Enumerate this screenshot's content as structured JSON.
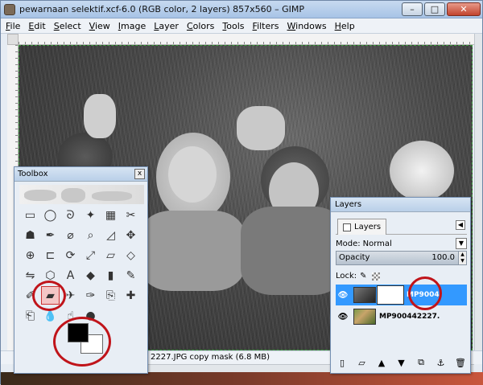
{
  "window": {
    "title": "pewarnaan selektif.xcf-6.0 (RGB color, 2 layers) 857x560 – GIMP",
    "controls": {
      "minimize": "–",
      "maximize": "□",
      "close": "✕"
    }
  },
  "menubar": [
    "File",
    "Edit",
    "Select",
    "View",
    "Image",
    "Layer",
    "Colors",
    "Tools",
    "Filters",
    "Windows",
    "Help"
  ],
  "status": {
    "text": "2227.JPG copy mask (6.8 MB)"
  },
  "toolbox": {
    "title": "Toolbox",
    "close": "x",
    "tools": [
      {
        "name": "rect-select-icon",
        "glyph": "▭"
      },
      {
        "name": "ellipse-select-icon",
        "glyph": "◯"
      },
      {
        "name": "lasso-icon",
        "glyph": "ᘐ"
      },
      {
        "name": "fuzzy-select-icon",
        "glyph": "✦"
      },
      {
        "name": "color-select-icon",
        "glyph": "▦"
      },
      {
        "name": "scissors-icon",
        "glyph": "✂"
      },
      {
        "name": "foreground-select-icon",
        "glyph": "☗"
      },
      {
        "name": "paths-icon",
        "glyph": "✒"
      },
      {
        "name": "color-picker-icon",
        "glyph": "⌀"
      },
      {
        "name": "zoom-icon",
        "glyph": "⌕"
      },
      {
        "name": "measure-icon",
        "glyph": "◿"
      },
      {
        "name": "move-icon",
        "glyph": "✥"
      },
      {
        "name": "align-icon",
        "glyph": "⊕"
      },
      {
        "name": "crop-icon",
        "glyph": "⊏"
      },
      {
        "name": "rotate-icon",
        "glyph": "⟳"
      },
      {
        "name": "scale-icon",
        "glyph": "⤢"
      },
      {
        "name": "shear-icon",
        "glyph": "▱"
      },
      {
        "name": "perspective-icon",
        "glyph": "◇"
      },
      {
        "name": "flip-icon",
        "glyph": "⇋"
      },
      {
        "name": "cage-icon",
        "glyph": "⬡"
      },
      {
        "name": "text-icon",
        "glyph": "A"
      },
      {
        "name": "bucket-fill-icon",
        "glyph": "◆"
      },
      {
        "name": "blend-icon",
        "glyph": "▮"
      },
      {
        "name": "pencil-icon",
        "glyph": "✎"
      },
      {
        "name": "paintbrush-icon",
        "glyph": "✐"
      },
      {
        "name": "eraser-icon",
        "glyph": "▰"
      },
      {
        "name": "airbrush-icon",
        "glyph": "✈"
      },
      {
        "name": "ink-icon",
        "glyph": "✑"
      },
      {
        "name": "clone-icon",
        "glyph": "⎘"
      },
      {
        "name": "heal-icon",
        "glyph": "✚"
      },
      {
        "name": "perspective-clone-icon",
        "glyph": "⎗"
      },
      {
        "name": "blur-icon",
        "glyph": "💧"
      },
      {
        "name": "smudge-icon",
        "glyph": "☝"
      },
      {
        "name": "dodge-burn-icon",
        "glyph": "●"
      }
    ],
    "selected_tool": "eraser-icon"
  },
  "layers": {
    "title": "Layers",
    "tab_label": "Layers",
    "mode_label": "Mode:",
    "mode_value": "Normal",
    "opacity_label": "Opacity",
    "opacity_value": "100.0",
    "lock_label": "Lock:",
    "rows": [
      {
        "name": "MP9004",
        "selected": true
      },
      {
        "name": "MP900442227.",
        "selected": false
      }
    ],
    "buttons": [
      {
        "name": "new-layer-icon",
        "glyph": "▯"
      },
      {
        "name": "new-group-icon",
        "glyph": "▱"
      },
      {
        "name": "raise-layer-icon",
        "glyph": "▲"
      },
      {
        "name": "lower-layer-icon",
        "glyph": "▼"
      },
      {
        "name": "duplicate-layer-icon",
        "glyph": "⧉"
      },
      {
        "name": "anchor-layer-icon",
        "glyph": "⚓"
      },
      {
        "name": "delete-layer-icon",
        "glyph": "🗑"
      }
    ]
  },
  "colors": {
    "selection": "#3399ff",
    "highlight_ring": "#c0141a"
  }
}
